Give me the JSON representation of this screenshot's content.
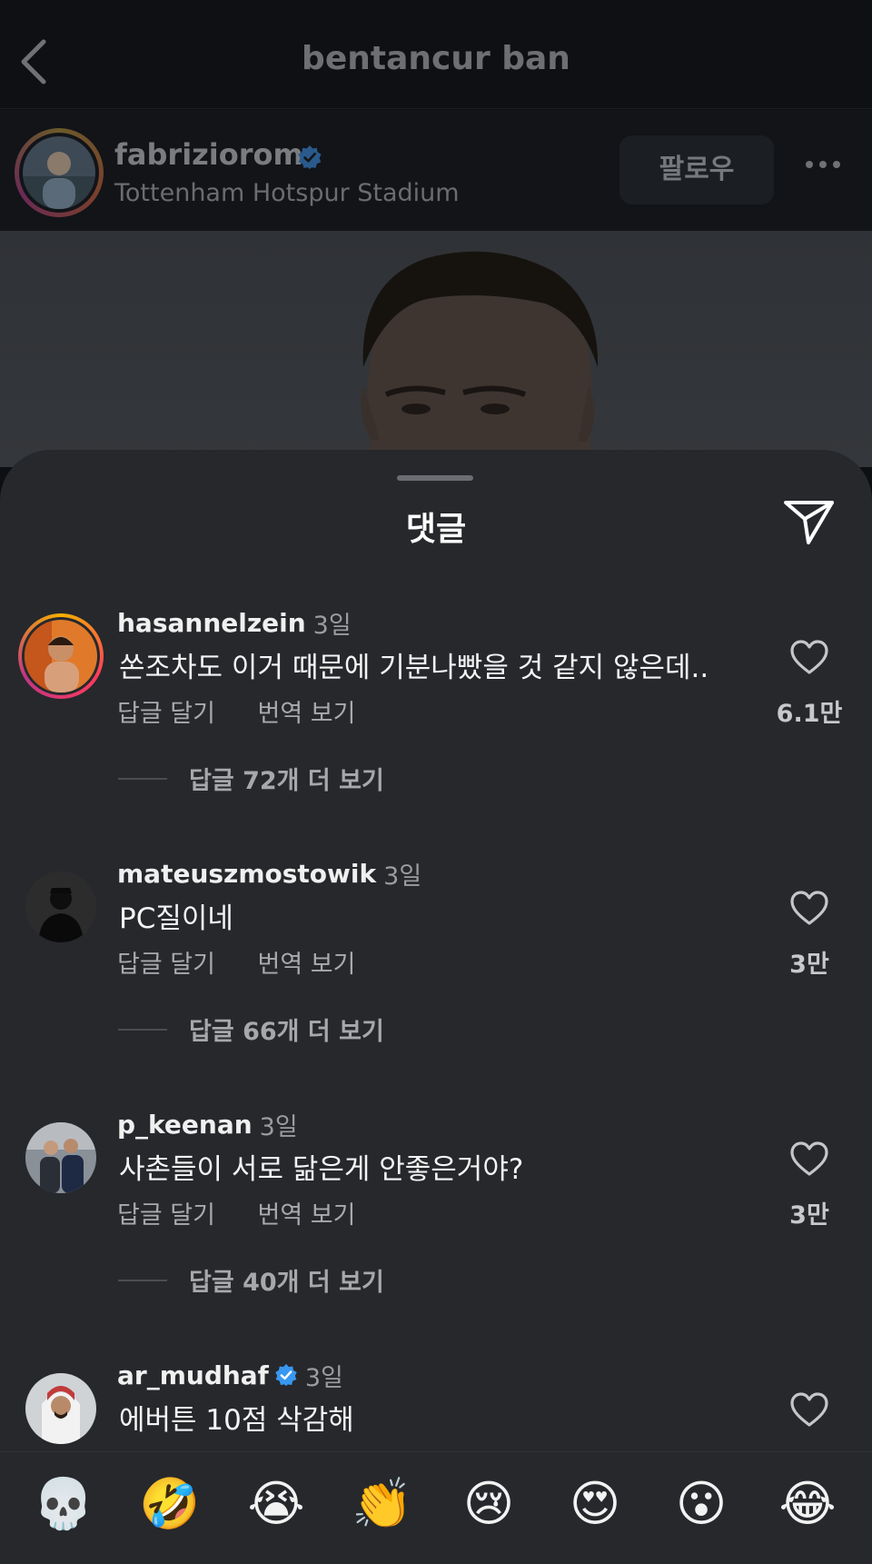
{
  "header": {
    "title": "bentancur ban"
  },
  "post": {
    "username": "fabriziorom",
    "location": "Tottenham Hotspur Stadium",
    "follow_label": "팔로우"
  },
  "sheet": {
    "title": "댓글"
  },
  "comment_actions": {
    "reply": "답글 달기",
    "translate": "번역 보기"
  },
  "comments": [
    {
      "username": "hasannelzein",
      "time": "3일",
      "text": "쏜조차도 이거 때문에 기분나빴을 것 같지 않은데..",
      "likes": "6.1만",
      "replies": "답글 72개 더 보기",
      "verified": false
    },
    {
      "username": "mateuszmostowik",
      "time": "3일",
      "text": "PC질이네",
      "likes": "3만",
      "replies": "답글 66개 더 보기",
      "verified": false
    },
    {
      "username": "p_keenan",
      "time": "3일",
      "text": "사촌들이 서로 닮은게 안좋은거야?",
      "likes": "3만",
      "replies": "답글 40개 더 보기",
      "verified": false
    },
    {
      "username": "ar_mudhaf",
      "time": "3일",
      "text": "에버튼 10점 삭감해",
      "verified": true
    }
  ],
  "emoji_bar": [
    "💀",
    "🤣",
    "😭",
    "👏",
    "😢",
    "😍",
    "😮",
    "😂"
  ],
  "colors": {
    "verified": "#3897f0",
    "sheet_bg": "#26282c",
    "background": "#0d0f12"
  },
  "icons": [
    "back-chevron-icon",
    "verified-badge-icon",
    "more-dots-icon",
    "share-send-icon",
    "heart-icon"
  ]
}
